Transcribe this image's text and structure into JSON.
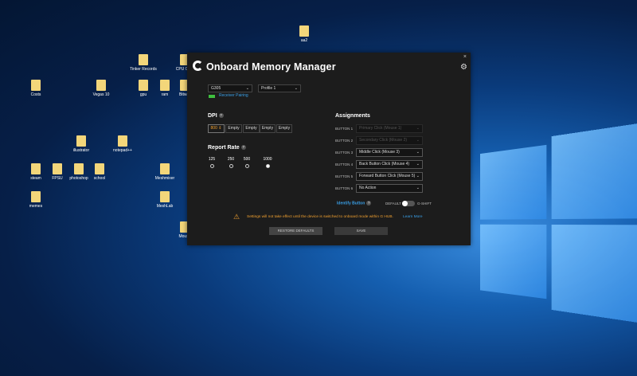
{
  "desktop": {
    "icons": [
      {
        "label": "aa2"
      },
      {
        "label": "Costs"
      },
      {
        "label": "Vegas 10"
      },
      {
        "label": "Tinker Records"
      },
      {
        "label": "gpu"
      },
      {
        "label": "ram"
      },
      {
        "label": "CPU CPU"
      },
      {
        "label": "Bitwar"
      },
      {
        "label": "illustrator"
      },
      {
        "label": "notepad++"
      },
      {
        "label": "steam"
      },
      {
        "label": "FPSU"
      },
      {
        "label": "photoshop"
      },
      {
        "label": "school"
      },
      {
        "label": "Meshmixer"
      },
      {
        "label": "memes"
      },
      {
        "label": "MeshLab"
      },
      {
        "label": "Mouse"
      }
    ]
  },
  "window": {
    "title": "Onboard Memory Manager",
    "close": "×",
    "device": "G305",
    "profile": "Profile 1",
    "receiver_pairing": "Receiver Pairing",
    "dpi_label": "DPI",
    "dpi_slots": [
      "800",
      "Empty",
      "Empty",
      "Empty",
      "Empty"
    ],
    "report_rate_label": "Report Rate",
    "report_rates": [
      "125",
      "250",
      "500",
      "1000"
    ],
    "selected_rate": "1000",
    "assignments_label": "Assignments",
    "buttons": [
      {
        "label": "BUTTON 1",
        "value": "Primary Click (Mouse 1)",
        "disabled": true
      },
      {
        "label": "BUTTON 2",
        "value": "Secondary Click (Mouse 2)",
        "disabled": true
      },
      {
        "label": "BUTTON 3",
        "value": "Middle Click (Mouse 3)",
        "disabled": false
      },
      {
        "label": "BUTTON 4",
        "value": "Back Button Click (Mouse 4)",
        "disabled": false
      },
      {
        "label": "BUTTON 5",
        "value": "Forward Button Click (Mouse 5)",
        "disabled": false
      },
      {
        "label": "BUTTON 6",
        "value": "No Action",
        "disabled": false
      }
    ],
    "identify_button": "Identify Button",
    "toggle_default": "DEFAULT",
    "toggle_gshift": "G-SHIFT",
    "warning": "Settings will not take effect until the device is switched to onboard mode within G HUB.",
    "learn_more": "Learn More",
    "restore_defaults": "RESTORE DEFAULTS",
    "save": "SAVE"
  },
  "colors": {
    "accent": "#3aa0e8",
    "warning": "#f0a030",
    "battery": "#3fbf3f"
  }
}
